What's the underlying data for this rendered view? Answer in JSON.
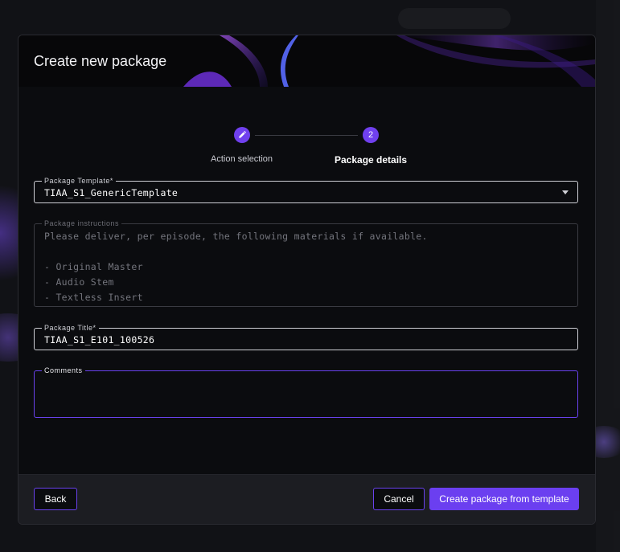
{
  "modal": {
    "title": "Create new package"
  },
  "stepper": {
    "steps": [
      {
        "label": "Action selection",
        "icon": "pencil-icon"
      },
      {
        "number": "2",
        "label": "Package details"
      }
    ]
  },
  "form": {
    "template": {
      "label": "Package Template*",
      "value": "TIAA_S1_GenericTemplate"
    },
    "instructions": {
      "label": "Package instructions",
      "lines": [
        "Please deliver, per episode, the following materials if available.",
        "",
        "- Original Master",
        "- Audio Stem",
        "- Textless Insert"
      ]
    },
    "title": {
      "label": "Package Title*",
      "value": "TIAA_S1_E101_100526"
    },
    "comments": {
      "label": "Comments",
      "value": ""
    }
  },
  "footer": {
    "back_label": "Back",
    "cancel_label": "Cancel",
    "create_label": "Create package from template"
  },
  "colors": {
    "accent": "#6b3ff0",
    "background": "#0b0c0f",
    "footer": "#1c1d22"
  }
}
